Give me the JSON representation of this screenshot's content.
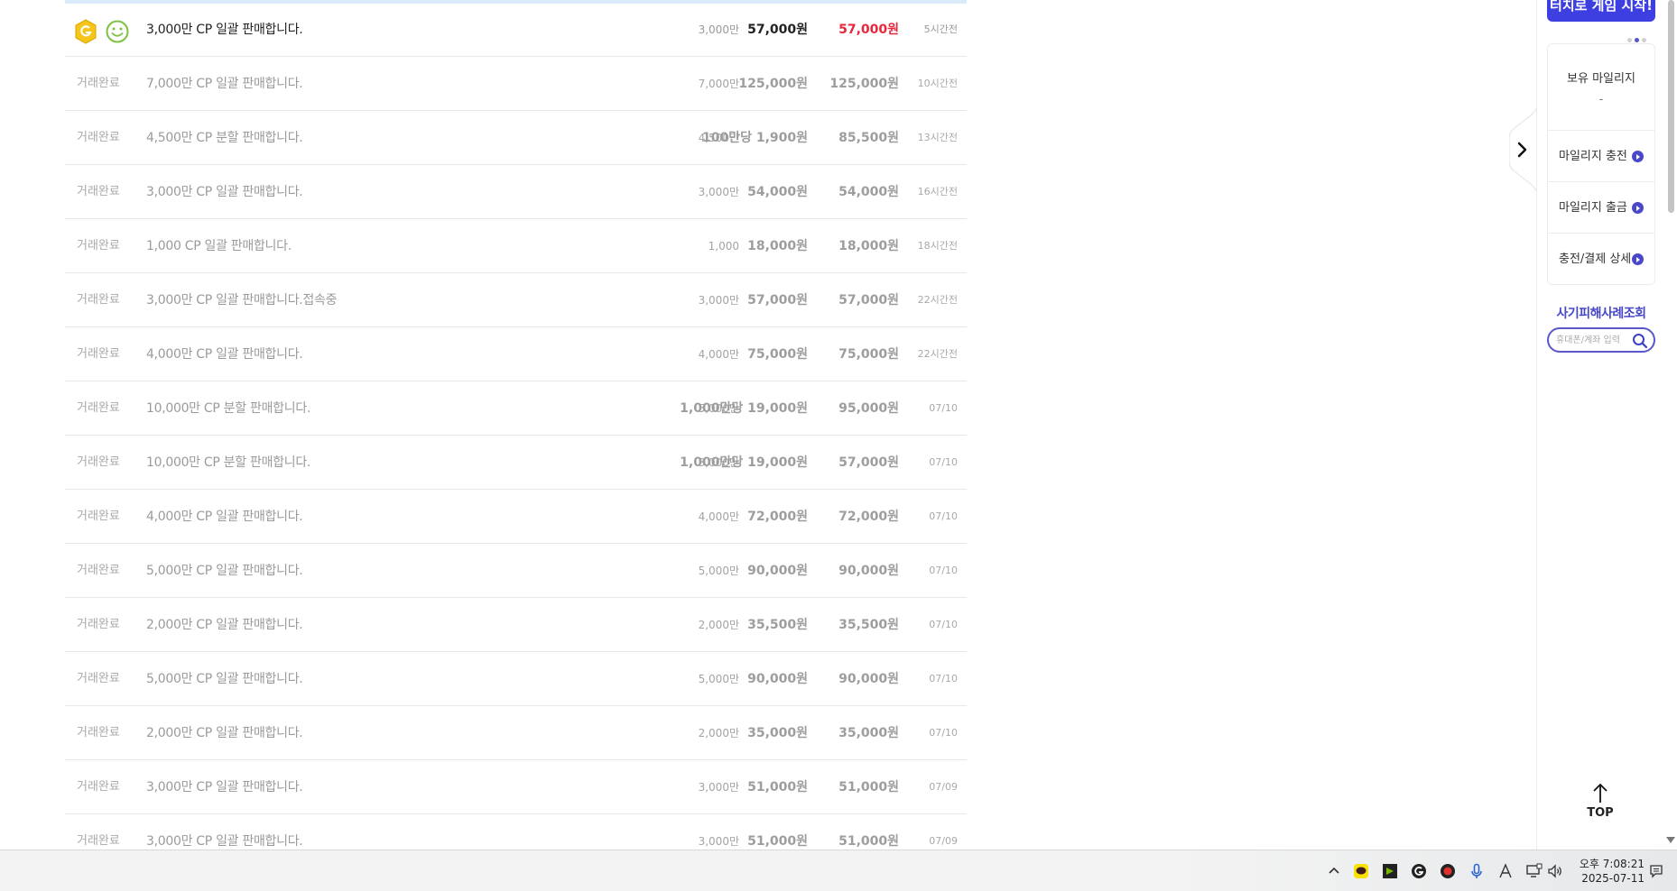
{
  "listing": {
    "rows": [
      {
        "status": "",
        "title": "3,000만 CP 일괄 판매합니다.",
        "qty": "3,000만",
        "unit": "57,000원",
        "total": "57,000원",
        "time": "5시간전"
      },
      {
        "status": "거래완료",
        "title": "7,000만 CP 일괄 판매합니다.",
        "qty": "7,000만",
        "unit": "125,000원",
        "total": "125,000원",
        "time": "10시간전"
      },
      {
        "status": "거래완료",
        "title": "4,500만 CP 분할 판매합니다.",
        "qty": "4,500만",
        "unit": "100만당 1,900원",
        "total": "85,500원",
        "time": "13시간전"
      },
      {
        "status": "거래완료",
        "title": "3,000만 CP 일괄 판매합니다.",
        "qty": "3,000만",
        "unit": "54,000원",
        "total": "54,000원",
        "time": "16시간전"
      },
      {
        "status": "거래완료",
        "title": "1,000 CP 일괄 판매합니다.",
        "qty": "1,000",
        "unit": "18,000원",
        "total": "18,000원",
        "time": "18시간전"
      },
      {
        "status": "거래완료",
        "title": "3,000만 CP 일괄 판매합니다.접속중",
        "qty": "3,000만",
        "unit": "57,000원",
        "total": "57,000원",
        "time": "22시간전"
      },
      {
        "status": "거래완료",
        "title": "4,000만 CP 일괄 판매합니다.",
        "qty": "4,000만",
        "unit": "75,000원",
        "total": "75,000원",
        "time": "22시간전"
      },
      {
        "status": "거래완료",
        "title": "10,000만 CP 분할 판매합니다.",
        "qty": "5,000만",
        "unit": "1,000만당 19,000원",
        "total": "95,000원",
        "time": "07/10"
      },
      {
        "status": "거래완료",
        "title": "10,000만 CP 분할 판매합니다.",
        "qty": "3,000만",
        "unit": "1,000만당 19,000원",
        "total": "57,000원",
        "time": "07/10"
      },
      {
        "status": "거래완료",
        "title": "4,000만 CP 일괄 판매합니다.",
        "qty": "4,000만",
        "unit": "72,000원",
        "total": "72,000원",
        "time": "07/10"
      },
      {
        "status": "거래완료",
        "title": "5,000만 CP 일괄 판매합니다.",
        "qty": "5,000만",
        "unit": "90,000원",
        "total": "90,000원",
        "time": "07/10"
      },
      {
        "status": "거래완료",
        "title": "2,000만 CP 일괄 판매합니다.",
        "qty": "2,000만",
        "unit": "35,500원",
        "total": "35,500원",
        "time": "07/10"
      },
      {
        "status": "거래완료",
        "title": "5,000만 CP 일괄 판매합니다.",
        "qty": "5,000만",
        "unit": "90,000원",
        "total": "90,000원",
        "time": "07/10"
      },
      {
        "status": "거래완료",
        "title": "2,000만 CP 일괄 판매합니다.",
        "qty": "2,000만",
        "unit": "35,000원",
        "total": "35,000원",
        "time": "07/10"
      },
      {
        "status": "거래완료",
        "title": "3,000만 CP 일괄 판매합니다.",
        "qty": "3,000만",
        "unit": "51,000원",
        "total": "51,000원",
        "time": "07/09"
      },
      {
        "status": "거래완료",
        "title": "3,000만 CP 일괄 판매합니다.",
        "qty": "3,000만",
        "unit": "51,000원",
        "total": "51,000원",
        "time": "07/09"
      }
    ]
  },
  "side": {
    "game_button": "터치로 게임 시작!",
    "mileage_title": "보유 마일리지",
    "mileage_value": "-",
    "menu": [
      {
        "label": "마일리지 충전"
      },
      {
        "label": "마일리지 출금"
      },
      {
        "label": "충전/결제 상세"
      }
    ],
    "fraud_title": "사기피해사례조회",
    "fraud_placeholder": "휴대폰/계좌 입력",
    "top_label": "TOP"
  },
  "taskbar": {
    "time": "오후 7:08:21",
    "date": "2025-07-11",
    "tray_icons": [
      "chevron-up-icon",
      "kakaotalk-icon",
      "nvidia-icon",
      "g-app-icon",
      "red-app-icon",
      "mic-icon",
      "ime-a-icon",
      "network-icon",
      "volume-icon",
      "notification-icon"
    ]
  },
  "colors": {
    "accent": "#3d3fe0",
    "price_red": "#e8263c",
    "muted_text": "#9a9a9a"
  }
}
